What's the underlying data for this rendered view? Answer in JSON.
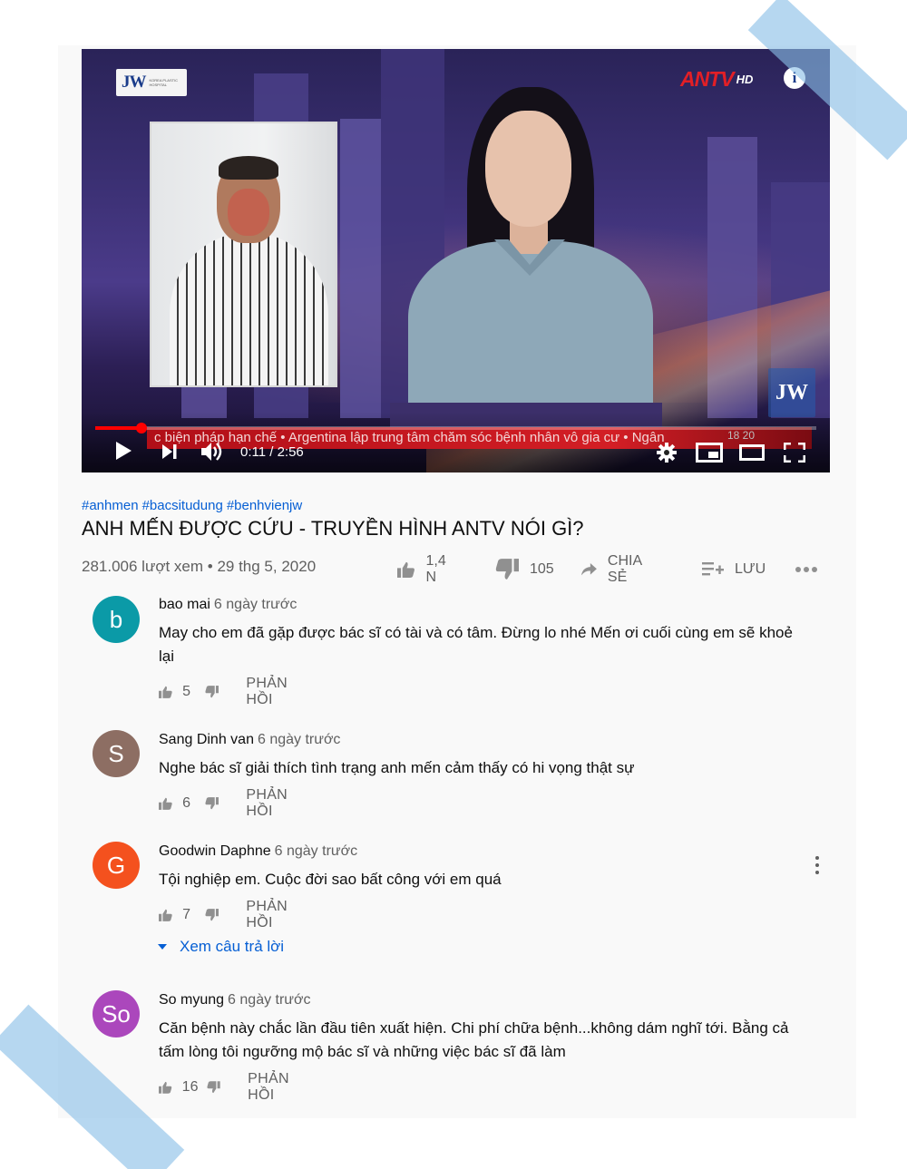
{
  "video": {
    "time": "0:11 / 2:56",
    "progress_fraction": 0.064,
    "channel_logo": "JW",
    "channel_logo_small": "KOREA PLASTIC HOSPITAL",
    "broadcaster": "ANTV",
    "broadcaster_hd": "HD",
    "corner_logo": "JW",
    "ticker": "c biện pháp hạn chế  •  Argentina lập trung tâm chăm sóc bệnh nhân vô gia cư  •  Ngân",
    "clock": "18 20",
    "controls": [
      "play-icon",
      "next-icon",
      "volume-icon",
      "settings-icon",
      "miniplayer-icon",
      "theater-icon",
      "fullscreen-icon"
    ]
  },
  "meta": {
    "hashtags": [
      "#anhmen",
      "#bacsitudung",
      "#benhvienjw"
    ],
    "title": "ANH MẾN ĐƯỢC CỨU - TRUYỀN HÌNH ANTV NÓI GÌ?",
    "stats": "281.006 lượt xem • 29 thg 5, 2020",
    "like_count": "1,4 N",
    "dislike_count": "105",
    "share_label": "CHIA SẺ",
    "save_label": "LƯU"
  },
  "comments": [
    {
      "avatar": "b",
      "avatar_color": "#0b9aa7",
      "author": "bao mai",
      "time": "6 ngày trước",
      "text": "May cho em đã gặp được bác sĩ có tài và có tâm. Đừng lo nhé Mến ơi cuối cùng em sẽ khoẻ lại",
      "likes": "5",
      "reply_label": "PHẢN HỒI"
    },
    {
      "avatar": "S",
      "avatar_color": "#8d6e63",
      "author": "Sang Dinh van",
      "time": "6 ngày trước",
      "text": "Nghe bác sĩ giải thích tình trạng anh mến cảm thấy có hi vọng thật sự",
      "likes": "6",
      "reply_label": "PHẢN HỒI"
    },
    {
      "avatar": "G",
      "avatar_color": "#f4511e",
      "author": "Goodwin Daphne",
      "time": "6 ngày trước",
      "text": "Tội nghiệp em. Cuộc đời sao bất công với em quá",
      "likes": "7",
      "reply_label": "PHẢN HỒI",
      "view_replies": "Xem câu trả lời"
    },
    {
      "avatar": "So",
      "avatar_color": "#ab47bc",
      "author": "So myung",
      "time": "6 ngày trước",
      "text": "Căn bệnh này chắc lần đầu tiên xuất hiện. Chi phí chữa bệnh...không dám nghĩ tới. Bằng cả tấm lòng tôi ngưỡng mộ bác sĩ và những việc bác sĩ đã làm",
      "likes": "16",
      "reply_label": "PHẢN HỒI"
    }
  ]
}
